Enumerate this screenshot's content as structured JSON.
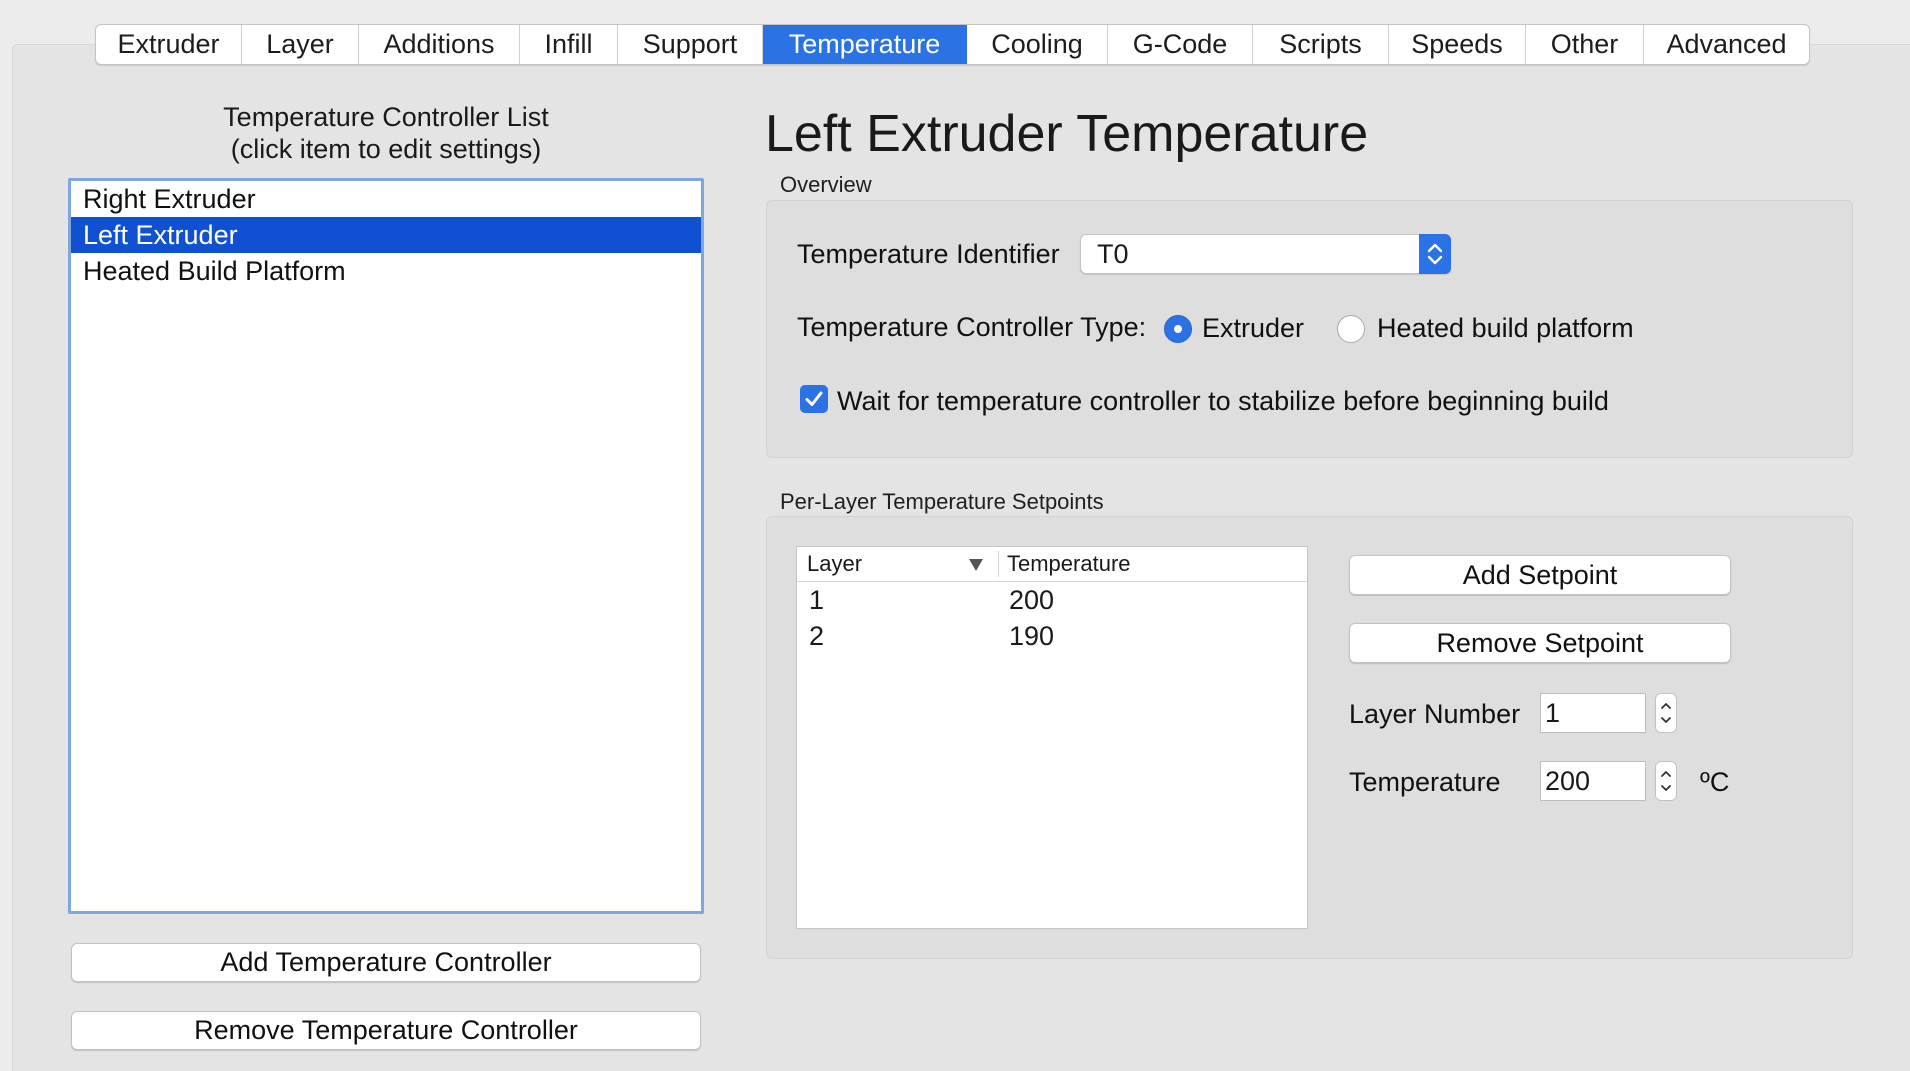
{
  "tabs": [
    {
      "label": "Extruder",
      "active": false
    },
    {
      "label": "Layer",
      "active": false
    },
    {
      "label": "Additions",
      "active": false
    },
    {
      "label": "Infill",
      "active": false
    },
    {
      "label": "Support",
      "active": false
    },
    {
      "label": "Temperature",
      "active": true
    },
    {
      "label": "Cooling",
      "active": false
    },
    {
      "label": "G-Code",
      "active": false
    },
    {
      "label": "Scripts",
      "active": false
    },
    {
      "label": "Speeds",
      "active": false
    },
    {
      "label": "Other",
      "active": false
    },
    {
      "label": "Advanced",
      "active": false
    }
  ],
  "controller_list": {
    "title_line1": "Temperature Controller List",
    "title_line2": "(click item to edit settings)",
    "items": [
      {
        "label": "Right Extruder",
        "selected": false
      },
      {
        "label": "Left Extruder",
        "selected": true
      },
      {
        "label": "Heated Build Platform",
        "selected": false
      }
    ],
    "add_button": "Add Temperature Controller",
    "remove_button": "Remove Temperature Controller"
  },
  "detail": {
    "title": "Left Extruder Temperature",
    "overview": {
      "label": "Overview",
      "identifier_label": "Temperature Identifier",
      "identifier_value": "T0",
      "type_label": "Temperature Controller Type:",
      "type_options": [
        {
          "label": "Extruder",
          "selected": true
        },
        {
          "label": "Heated build platform",
          "selected": false
        }
      ],
      "wait_checkbox_label": "Wait for temperature controller to stabilize before beginning build",
      "wait_checked": true
    },
    "setpoints": {
      "label": "Per-Layer Temperature Setpoints",
      "columns": [
        "Layer",
        "Temperature"
      ],
      "rows": [
        {
          "layer": "1",
          "temperature": "200"
        },
        {
          "layer": "2",
          "temperature": "190"
        }
      ],
      "add_button": "Add Setpoint",
      "remove_button": "Remove Setpoint",
      "layer_number_label": "Layer Number",
      "layer_number_value": "1",
      "temperature_label": "Temperature",
      "temperature_value": "200",
      "unit": "ºC"
    }
  },
  "colors": {
    "accent": "#2b73e5",
    "selection": "#1051d1",
    "list_focus_ring": "#7ea6e0"
  }
}
